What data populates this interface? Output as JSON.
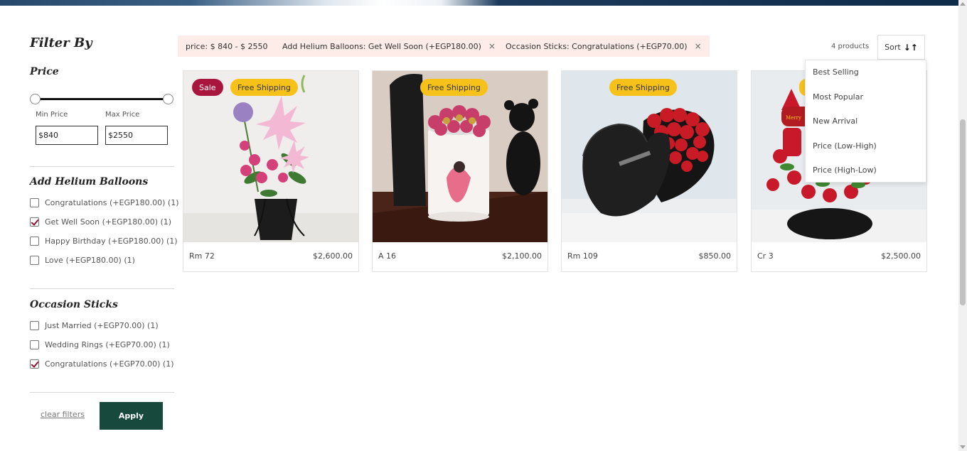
{
  "sidebar": {
    "title": "Filter By",
    "price": {
      "title": "Price",
      "min_label": "Min Price",
      "max_label": "Max Price",
      "min_value": "$840",
      "max_value": "$2550"
    },
    "balloons": {
      "title": "Add Helium Balloons",
      "items": [
        {
          "label": "Congratulations (+EGP180.00) (1)",
          "checked": false
        },
        {
          "label": "Get Well Soon (+EGP180.00) (1)",
          "checked": true
        },
        {
          "label": "Happy Birthday (+EGP180.00) (1)",
          "checked": false
        },
        {
          "label": "Love (+EGP180.00) (1)",
          "checked": false
        }
      ]
    },
    "sticks": {
      "title": "Occasion Sticks",
      "items": [
        {
          "label": "Just Married (+EGP70.00) (1)",
          "checked": false
        },
        {
          "label": "Wedding Rings (+EGP70.00) (1)",
          "checked": false
        },
        {
          "label": "Congratulations (+EGP70.00) (1)",
          "checked": true
        }
      ]
    },
    "clear_label": "clear filters",
    "apply_label": "Apply"
  },
  "chips": [
    {
      "label": "price: $ 840 - $ 2550",
      "removable": false
    },
    {
      "label": "Add Helium Balloons: Get Well Soon (+EGP180.00)",
      "removable": true
    },
    {
      "label": "Occasion Sticks: Congratulations (+EGP70.00)",
      "removable": true
    }
  ],
  "chip_close": "×",
  "toolbar": {
    "count": "4 products",
    "sort_label": "Sort",
    "sort_icon": "↓↑"
  },
  "sort_menu": [
    "Best Selling",
    "Most Popular",
    "New Arrival",
    "Price (Low-High)",
    "Price (High-Low)"
  ],
  "products": [
    {
      "name": "Rm 72",
      "price": "$2,600.00",
      "badges": [
        "Sale",
        "Free Shipping"
      ]
    },
    {
      "name": "A 16",
      "price": "$2,100.00",
      "badges": [
        "Free Shipping"
      ]
    },
    {
      "name": "Rm 109",
      "price": "$850.00",
      "badges": [
        "Free Shipping"
      ]
    },
    {
      "name": "Cr 3",
      "price": "$2,500.00",
      "badges": []
    }
  ],
  "colors": {
    "accent": "#17493d",
    "sale": "#a8163e",
    "shipping": "#f6c21a",
    "chip_bg": "#fdece8"
  }
}
